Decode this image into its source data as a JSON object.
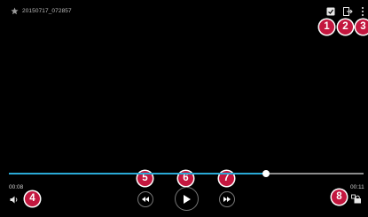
{
  "video": {
    "title": "20150717_072857",
    "elapsed": "00:08",
    "total": "00:11",
    "progress_fraction": 0.725
  },
  "icons": {
    "favorite": "star-icon",
    "share": "share-icon",
    "exit": "exit-icon",
    "more": "more-vert-icon",
    "volume": "volume-icon",
    "rewind": "rewind-icon",
    "play": "play-icon",
    "fast_forward": "fast-forward-icon",
    "screen_lock": "screen-lock-icon"
  },
  "callouts": [
    "1",
    "2",
    "3",
    "4",
    "5",
    "6",
    "7",
    "8"
  ],
  "colors": {
    "callout": "#c3173f",
    "seek_fill": "#2aa9d6",
    "seek_track": "#8c8c8c",
    "background": "#000000"
  }
}
